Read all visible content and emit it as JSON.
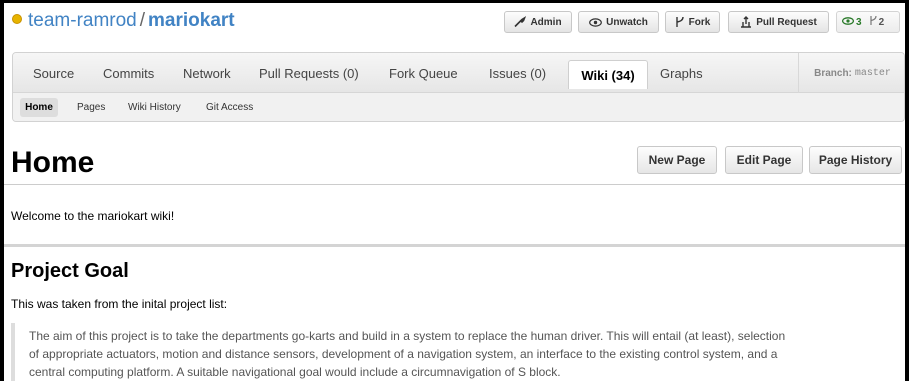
{
  "header": {
    "owner": "team-ramrod",
    "separator": "/",
    "repo": "mariokart",
    "buttons": {
      "admin": "Admin",
      "unwatch": "Unwatch",
      "fork": "Fork",
      "pull_request": "Pull Request"
    },
    "watchers_count": "3",
    "forks_count": "2"
  },
  "tabs": {
    "source": "Source",
    "commits": "Commits",
    "network": "Network",
    "pull_requests": "Pull Requests (0)",
    "fork_queue": "Fork Queue",
    "issues": "Issues (0)",
    "wiki": "Wiki (34)",
    "graphs": "Graphs",
    "branch_label": "Branch:",
    "branch_value": "master"
  },
  "subnav": {
    "home": "Home",
    "pages": "Pages",
    "wiki_history": "Wiki History",
    "git_access": "Git Access"
  },
  "page": {
    "title": "Home",
    "new_page": "New Page",
    "edit_page": "Edit Page",
    "page_history": "Page History",
    "welcome": "Welcome to the mariokart wiki!",
    "section_heading": "Project Goal",
    "intro": "This was taken from the inital project list:",
    "quote_lines": [
      "The aim of this project is to take the departments go-karts and build in a system to replace the human driver. This will entail (at least), selection",
      "of appropriate actuators, motion and distance sensors, development of a navigation system, an interface to the existing control system, and a",
      "central computing platform. A suitable navigational goal would include a circumnavigation of S block."
    ]
  },
  "colors": {
    "link": "#4183c4",
    "owner_dot": "#e7b400",
    "watch_green": "#2a7a2a"
  }
}
